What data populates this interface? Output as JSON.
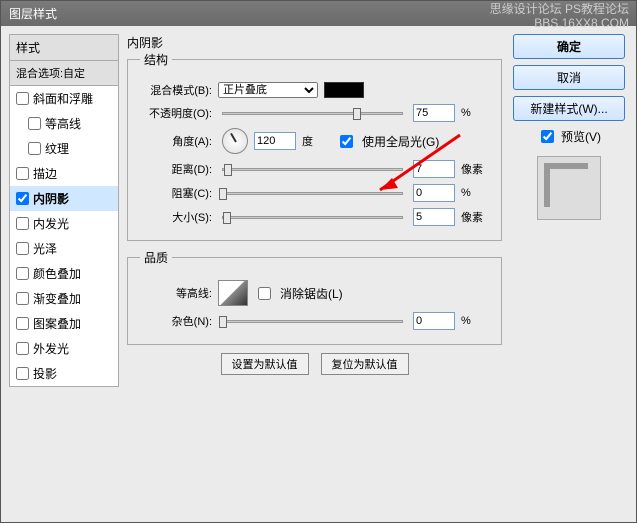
{
  "watermark": {
    "line1": "思缘设计论坛  PS教程论坛",
    "line2": "BBS.16XX8.COM"
  },
  "title": "图层样式",
  "left": {
    "header": "样式",
    "blend_options": "混合选项:自定",
    "items": [
      {
        "label": "斜面和浮雕",
        "checked": false,
        "indent": false,
        "selected": false
      },
      {
        "label": "等高线",
        "checked": false,
        "indent": true,
        "selected": false
      },
      {
        "label": "纹理",
        "checked": false,
        "indent": true,
        "selected": false
      },
      {
        "label": "描边",
        "checked": false,
        "indent": false,
        "selected": false
      },
      {
        "label": "内阴影",
        "checked": true,
        "indent": false,
        "selected": true
      },
      {
        "label": "内发光",
        "checked": false,
        "indent": false,
        "selected": false
      },
      {
        "label": "光泽",
        "checked": false,
        "indent": false,
        "selected": false
      },
      {
        "label": "颜色叠加",
        "checked": false,
        "indent": false,
        "selected": false
      },
      {
        "label": "渐变叠加",
        "checked": false,
        "indent": false,
        "selected": false
      },
      {
        "label": "图案叠加",
        "checked": false,
        "indent": false,
        "selected": false
      },
      {
        "label": "外发光",
        "checked": false,
        "indent": false,
        "selected": false
      },
      {
        "label": "投影",
        "checked": false,
        "indent": false,
        "selected": false
      }
    ]
  },
  "center": {
    "heading": "内阴影",
    "group_structure": "结构",
    "blend_mode_label": "混合模式(B):",
    "blend_mode_value": "正片叠底",
    "opacity_label": "不透明度(O):",
    "opacity_value": "75",
    "percent": "%",
    "angle_label": "角度(A):",
    "angle_value": "120",
    "degree": "度",
    "use_global_light": "使用全局光(G)",
    "distance_label": "距离(D):",
    "distance_value": "7",
    "pixel": "像素",
    "choke_label": "阻塞(C):",
    "choke_value": "0",
    "size_label": "大小(S):",
    "size_value": "5",
    "group_quality": "品质",
    "contour_label": "等高线:",
    "antialias": "消除锯齿(L)",
    "noise_label": "杂色(N):",
    "noise_value": "0",
    "btn_default": "设置为默认值",
    "btn_reset": "复位为默认值"
  },
  "right": {
    "ok": "确定",
    "cancel": "取消",
    "new_style": "新建样式(W)...",
    "preview": "预览(V)"
  }
}
